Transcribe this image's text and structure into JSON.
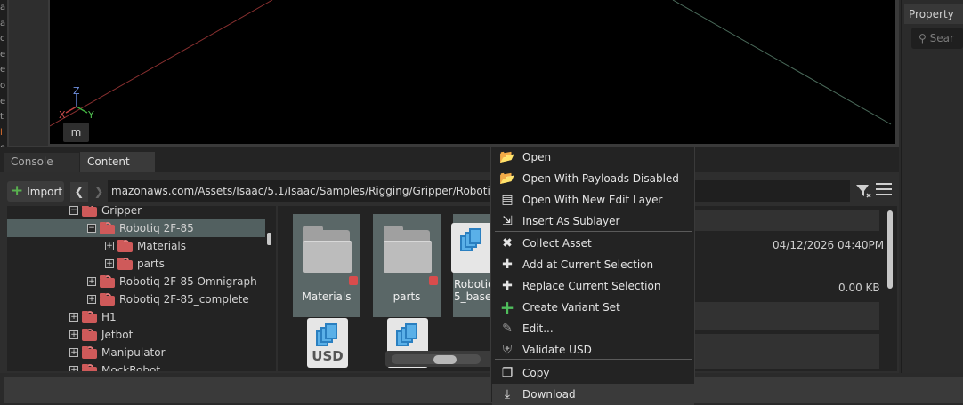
{
  "left_strip": {
    "chars": [
      "a",
      "a",
      "c",
      "e",
      "e",
      "o",
      "e",
      "t",
      "l",
      "o",
      "e",
      "o",
      "c",
      "e",
      "e"
    ],
    "highlight_indices": [
      8,
      11
    ]
  },
  "viewport": {
    "axis_labels": {
      "z": "Z",
      "x": "X",
      "y": "Y"
    },
    "unit_button": "m",
    "colors": {
      "x_axis": "#c04040",
      "y_axis": "#40b040",
      "z_axis": "#6080d0"
    }
  },
  "property_panel": {
    "tab_label": "Property",
    "search_placeholder": "Sear"
  },
  "bottom_tabs": [
    {
      "label": "Console",
      "active": false
    },
    {
      "label": "Content",
      "active": true
    }
  ],
  "toolbar": {
    "import_label": "Import",
    "back_icon": "chevron-left-icon",
    "forward_icon": "chevron-right-icon",
    "address": "mazonaws.com/Assets/Isaac/5.1/Isaac/Samples/Rigging/Gripper/Robotiq",
    "filter_icon": "filter-icon",
    "menu_icon": "hamburger-menu-icon"
  },
  "tree": {
    "rows": [
      {
        "label": "Gripper",
        "expander": "−",
        "indent": 1,
        "selected": false
      },
      {
        "label": "Robotiq 2F-85",
        "expander": "−",
        "indent": 2,
        "selected": true
      },
      {
        "label": "Materials",
        "expander": "+",
        "indent": 3,
        "selected": false
      },
      {
        "label": "parts",
        "expander": "+",
        "indent": 3,
        "selected": false
      },
      {
        "label": "Robotiq 2F-85 Omnigraph",
        "expander": "+",
        "indent": 2,
        "selected": false
      },
      {
        "label": "Robotiq 2F-85_complete",
        "expander": "+",
        "indent": 2,
        "selected": false
      },
      {
        "label": "H1",
        "expander": "+",
        "indent": 1,
        "selected": false
      },
      {
        "label": "Jetbot",
        "expander": "+",
        "indent": 1,
        "selected": false
      },
      {
        "label": "Manipulator",
        "expander": "+",
        "indent": 1,
        "selected": false
      },
      {
        "label": "MockRobot",
        "expander": "+",
        "indent": 1,
        "selected": false
      }
    ]
  },
  "grid": {
    "tiles": [
      {
        "label": "Materials",
        "type": "folder"
      },
      {
        "label": "parts",
        "type": "folder"
      },
      {
        "label": "Robotiq\n5_base",
        "type": "usd"
      }
    ],
    "usd_label": "USD"
  },
  "detail": {
    "date": "04/12/2026 04:40PM",
    "size": "0.00 KB"
  },
  "context_menu": {
    "items": [
      {
        "label": "Open",
        "icon": "folder-open-icon"
      },
      {
        "label": "Open With Payloads Disabled",
        "icon": "folder-open-icon"
      },
      {
        "label": "Open With New Edit Layer",
        "icon": "layer-icon"
      },
      {
        "label": "Insert As Sublayer",
        "icon": "insert-icon"
      },
      {
        "label": "Collect Asset",
        "icon": "collect-icon"
      },
      {
        "label": "Add at Current Selection",
        "icon": "plus-icon"
      },
      {
        "label": "Replace Current Selection",
        "icon": "plus-icon"
      },
      {
        "label": "Create Variant Set",
        "icon": "green-plus-icon"
      },
      {
        "label": "Edit...",
        "icon": "pencil-icon"
      },
      {
        "label": "Validate USD",
        "icon": "shield-check-icon"
      },
      {
        "label": "Copy",
        "icon": "copy-icon"
      },
      {
        "label": "Download",
        "icon": "download-icon"
      }
    ],
    "hovered": "Download"
  }
}
